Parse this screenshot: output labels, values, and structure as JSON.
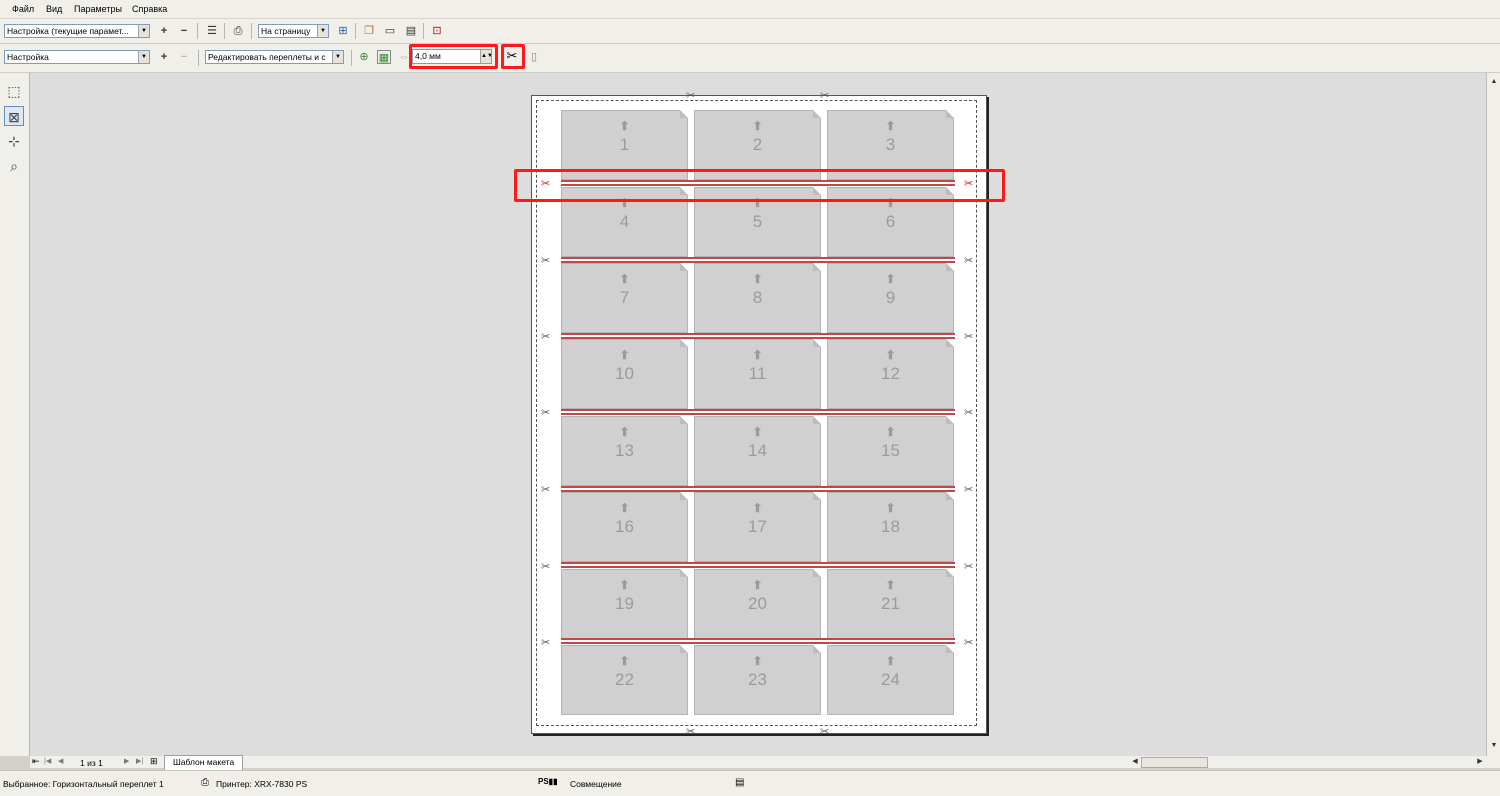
{
  "menu": [
    "Файл",
    "Вид",
    "Параметры",
    "Справка"
  ],
  "toolbar1": {
    "preset": "Настройка (текущие парамет...",
    "zoom": "На страницу"
  },
  "toolbar2": {
    "preset": "Настройка",
    "edit_mode": "Редактировать переплеты и с",
    "gutter_value": "4,0 мм"
  },
  "cards": [
    "1",
    "2",
    "3",
    "4",
    "5",
    "6",
    "7",
    "8",
    "9",
    "10",
    "11",
    "12",
    "13",
    "14",
    "15",
    "16",
    "17",
    "18",
    "19",
    "20",
    "21",
    "22",
    "23",
    "24"
  ],
  "page_nav": {
    "position": "1 из 1",
    "tab": "Шаблон макета"
  },
  "status": {
    "selected": "Выбранное: Горизонтальный переплет 1",
    "printer": "Принтер: XRX-7830 PS",
    "sep_label": "Совмещение"
  },
  "icons": {
    "scissors": "✂",
    "add": "+",
    "remove": "−",
    "up_arrow": "⬆"
  },
  "colors": {
    "highlight": "#ff1a1a",
    "binding_line": "#c24848",
    "card": "#d0d0d0"
  }
}
